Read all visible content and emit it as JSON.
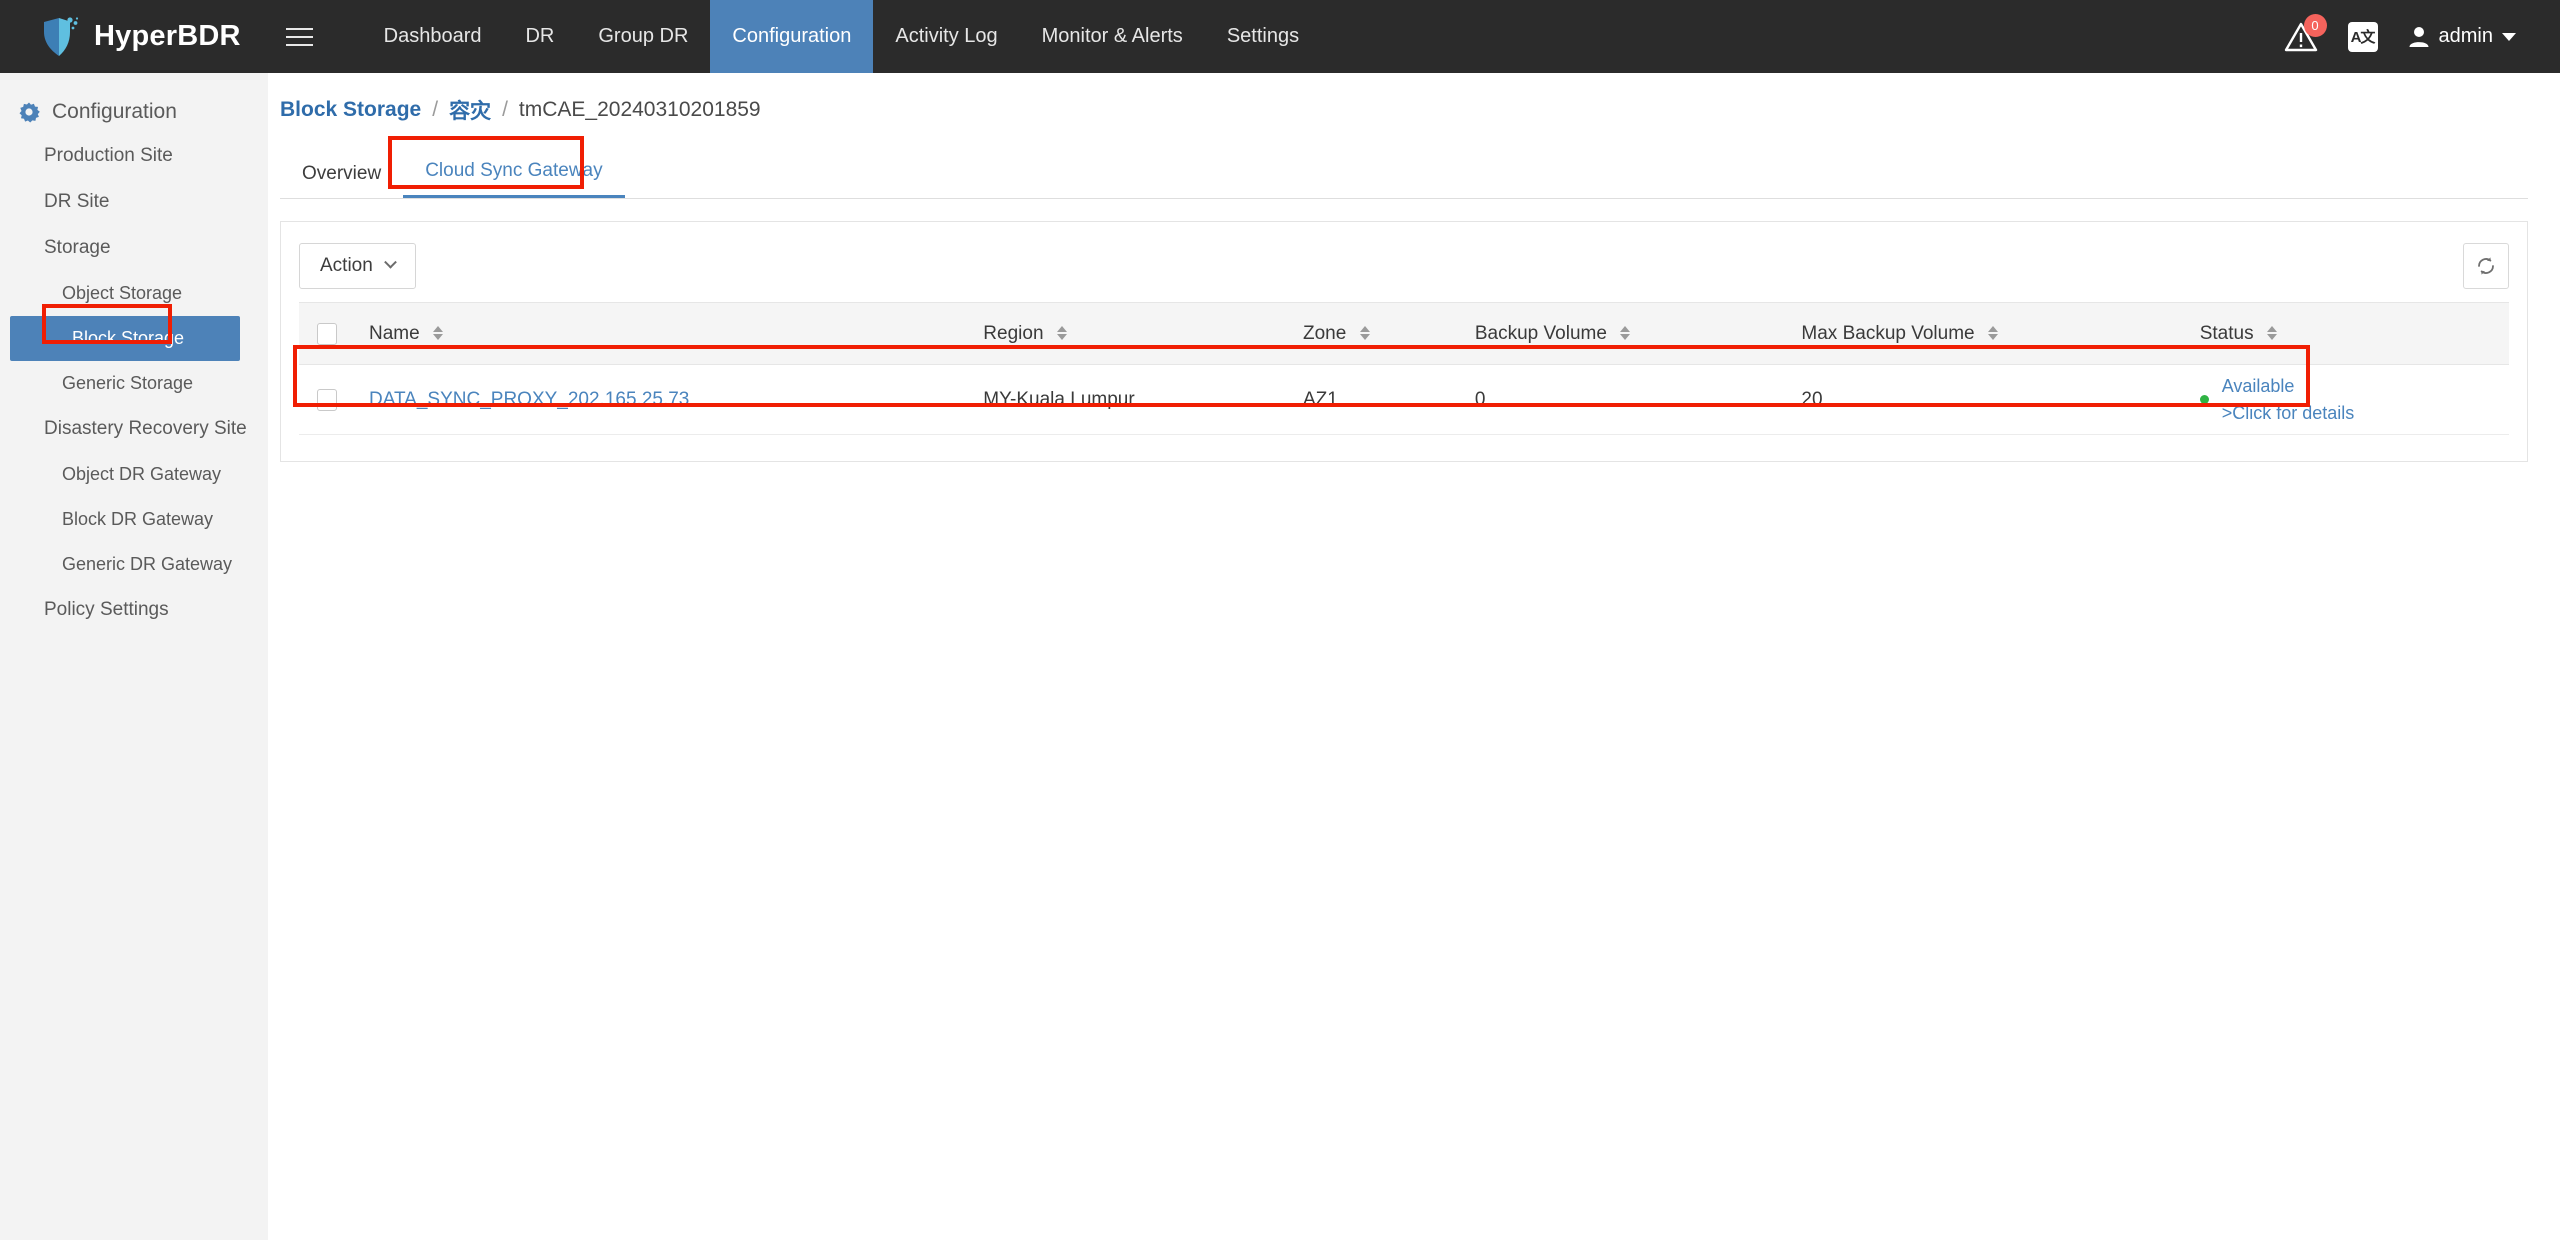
{
  "app": {
    "brand": "HyperBDR",
    "logo_icon": "shield-logo-icon",
    "menu_icon": "hamburger-menu-icon"
  },
  "topnav": {
    "items": [
      {
        "label": "Dashboard",
        "active": false
      },
      {
        "label": "DR",
        "active": false
      },
      {
        "label": "Group DR",
        "active": false
      },
      {
        "label": "Configuration",
        "active": true
      },
      {
        "label": "Activity Log",
        "active": false
      },
      {
        "label": "Monitor & Alerts",
        "active": false
      },
      {
        "label": "Settings",
        "active": false
      }
    ],
    "alert": {
      "icon": "alert-warning-icon",
      "badge": "0"
    },
    "language": {
      "icon": "translate-icon",
      "label": "A文"
    },
    "user": {
      "icon": "user-avatar-icon",
      "name": "admin",
      "caret": "chevron-down-icon"
    }
  },
  "sidebar": {
    "title": "Configuration",
    "title_icon": "gear-config-icon",
    "items": [
      {
        "label": "Production Site",
        "sub": false,
        "active": false
      },
      {
        "label": "DR Site",
        "sub": false,
        "active": false
      },
      {
        "label": "Storage",
        "sub": false,
        "active": false
      },
      {
        "label": "Object Storage",
        "sub": true,
        "active": false
      },
      {
        "label": "Block Storage",
        "sub": true,
        "active": true
      },
      {
        "label": "Generic Storage",
        "sub": true,
        "active": false
      },
      {
        "label": "Disastery Recovery Site",
        "sub": false,
        "active": false
      },
      {
        "label": "Object DR Gateway",
        "sub": true,
        "active": false
      },
      {
        "label": "Block DR Gateway",
        "sub": true,
        "active": false
      },
      {
        "label": "Generic DR Gateway",
        "sub": true,
        "active": false
      },
      {
        "label": "Policy Settings",
        "sub": false,
        "active": false
      }
    ]
  },
  "breadcrumb": {
    "root": "Block Storage",
    "sep1": "/",
    "middle": "容灾",
    "sep2": "/",
    "current": "tmCAE_20240310201859"
  },
  "tabs": [
    {
      "label": "Overview",
      "active": false
    },
    {
      "label": "Cloud Sync Gateway",
      "active": true
    }
  ],
  "toolbar": {
    "action_label": "Action",
    "action_caret": "chevron-down-icon",
    "refresh_icon": "refresh-icon"
  },
  "table": {
    "columns": [
      {
        "label": "Name",
        "sortable": true
      },
      {
        "label": "Region",
        "sortable": true
      },
      {
        "label": "Zone",
        "sortable": true
      },
      {
        "label": "Backup Volume",
        "sortable": true
      },
      {
        "label": "Max Backup Volume",
        "sortable": true
      },
      {
        "label": "Status",
        "sortable": true
      }
    ],
    "rows": [
      {
        "name": "DATA_SYNC_PROXY_202.165.25.73",
        "region": "MY-Kuala Lumpur",
        "zone": "AZ1",
        "backup_volume": "0",
        "max_backup_volume": "20",
        "status": "Available",
        "status_detail": ">Click for details",
        "status_dot_color": "#2fb344"
      }
    ]
  },
  "colors": {
    "topnav_bg": "#2b2b2b",
    "accent_blue": "#4d82b8",
    "link_blue": "#4a84bd",
    "annotation_red": "#f01e03",
    "status_green": "#2fb344",
    "sidebar_bg": "#f3f3f3"
  }
}
